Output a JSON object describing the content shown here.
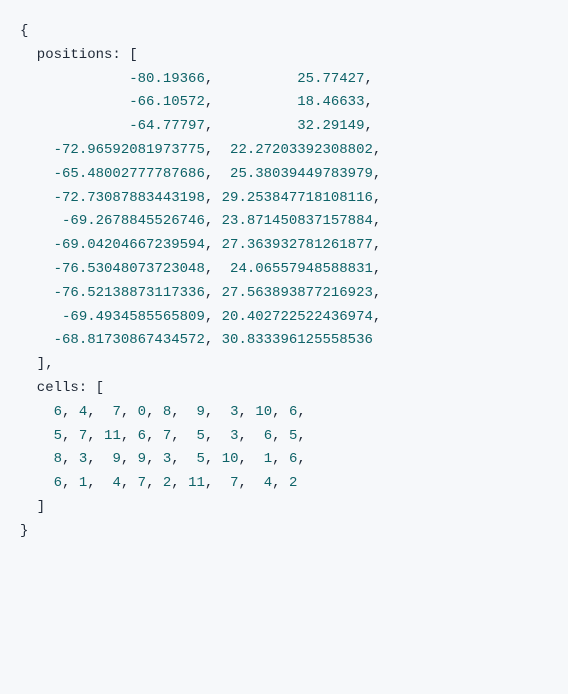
{
  "open": "{",
  "positionsKey": "  positions: [",
  "posRows": [
    [
      "           -80.19366",
      "          25.77427"
    ],
    [
      "           -66.10572",
      "          18.46633"
    ],
    [
      "           -64.77797",
      "          32.29149"
    ],
    [
      "  -72.96592081973775",
      "  22.27203392308802"
    ],
    [
      "  -65.48002777787686",
      "  25.38039449783979"
    ],
    [
      "  -72.73087883443198",
      " 29.253847718108116"
    ],
    [
      "   -69.2678845526746",
      " 23.871450837157884"
    ],
    [
      "  -69.04204667239594",
      " 27.363932781261877"
    ],
    [
      "  -76.53048073723048",
      "  24.06557948588831"
    ],
    [
      "  -76.52138873117336",
      " 27.563893877216923"
    ],
    [
      "   -69.4934585565809",
      " 20.402722522436974"
    ],
    [
      "  -68.81730867434572",
      " 30.833396125558536"
    ]
  ],
  "closeBracket": "  ],",
  "cellsKey": "  cells: [",
  "cellRows": [
    [
      "    ",
      "6",
      ", ",
      "4",
      ",  ",
      "7",
      ", ",
      "0",
      ", ",
      "8",
      ",  ",
      "9",
      ",  ",
      "3",
      ", ",
      "10",
      ", ",
      "6",
      ","
    ],
    [
      "    ",
      "5",
      ", ",
      "7",
      ", ",
      "11",
      ", ",
      "6",
      ", ",
      "7",
      ",  ",
      "5",
      ",  ",
      "3",
      ",  ",
      "6",
      ", ",
      "5",
      ","
    ],
    [
      "    ",
      "8",
      ", ",
      "3",
      ",  ",
      "9",
      ", ",
      "9",
      ", ",
      "3",
      ",  ",
      "5",
      ", ",
      "10",
      ",  ",
      "1",
      ", ",
      "6",
      ","
    ],
    [
      "    ",
      "6",
      ", ",
      "1",
      ",  ",
      "4",
      ", ",
      "7",
      ", ",
      "2",
      ", ",
      "11",
      ",  ",
      "7",
      ",  ",
      "4",
      ", ",
      "2",
      ""
    ]
  ],
  "cellsBracket": "  ]",
  "close": "}"
}
